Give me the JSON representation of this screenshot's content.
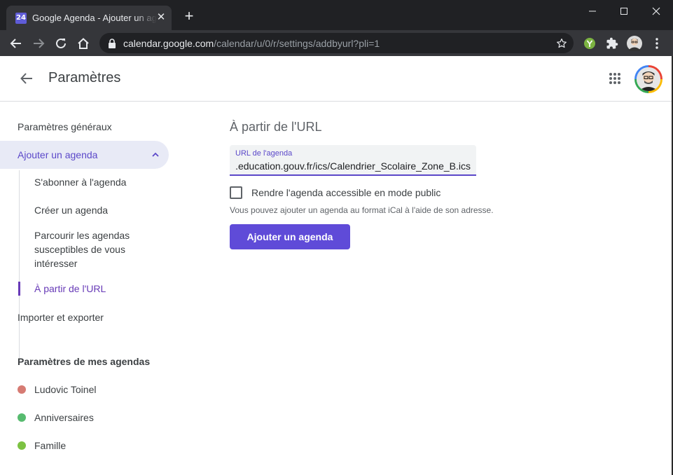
{
  "browser": {
    "tab": {
      "favicon_text": "24",
      "title": "Google Agenda - Ajouter un agenda"
    },
    "address": {
      "host": "calendar.google.com",
      "path": "/calendar/u/0/r/settings/addbyurl?pli=1"
    },
    "icons": {
      "close_tab": "close-icon",
      "new_tab": "plus-icon",
      "minimize": "minimize-icon",
      "maximize": "maximize-icon",
      "close_window": "close-icon",
      "back": "arrow-left-icon",
      "forward": "arrow-right-icon",
      "reload": "reload-icon",
      "home": "home-icon",
      "lock": "lock-icon",
      "bookmark": "star-icon",
      "extension": "puzzle-icon"
    }
  },
  "header": {
    "title": "Paramètres"
  },
  "sidebar": {
    "general": "Paramètres généraux",
    "add_calendar": "Ajouter un agenda",
    "sub_items": [
      "S'abonner à l'agenda",
      "Créer un agenda",
      "Parcourir les agendas susceptibles de vous intéresser",
      "À partir de l'URL"
    ],
    "import_export": "Importer et exporter",
    "my_calendars_heading": "Paramètres de mes agendas",
    "calendars": [
      {
        "name": "Ludovic Toinel",
        "color": "#d67b73"
      },
      {
        "name": "Anniversaires",
        "color": "#57bb6f"
      },
      {
        "name": "Famille",
        "color": "#7cc242"
      }
    ]
  },
  "main": {
    "title": "À partir de l'URL",
    "url_field": {
      "label": "URL de l'agenda",
      "value": "https://www.data.education.gouv.fr/ics/Calendrier_Scolaire_Zone_B.ics"
    },
    "public_checkbox": {
      "label": "Rendre l'agenda accessible en mode public",
      "checked": false
    },
    "help_text": "Vous pouvez ajouter un agenda au format iCal à l'aide de son adresse.",
    "add_button": "Ajouter un agenda"
  },
  "colors": {
    "accent": "#5f4bd8",
    "active_text": "#673ab7",
    "active_bg": "#e8eaf6"
  }
}
